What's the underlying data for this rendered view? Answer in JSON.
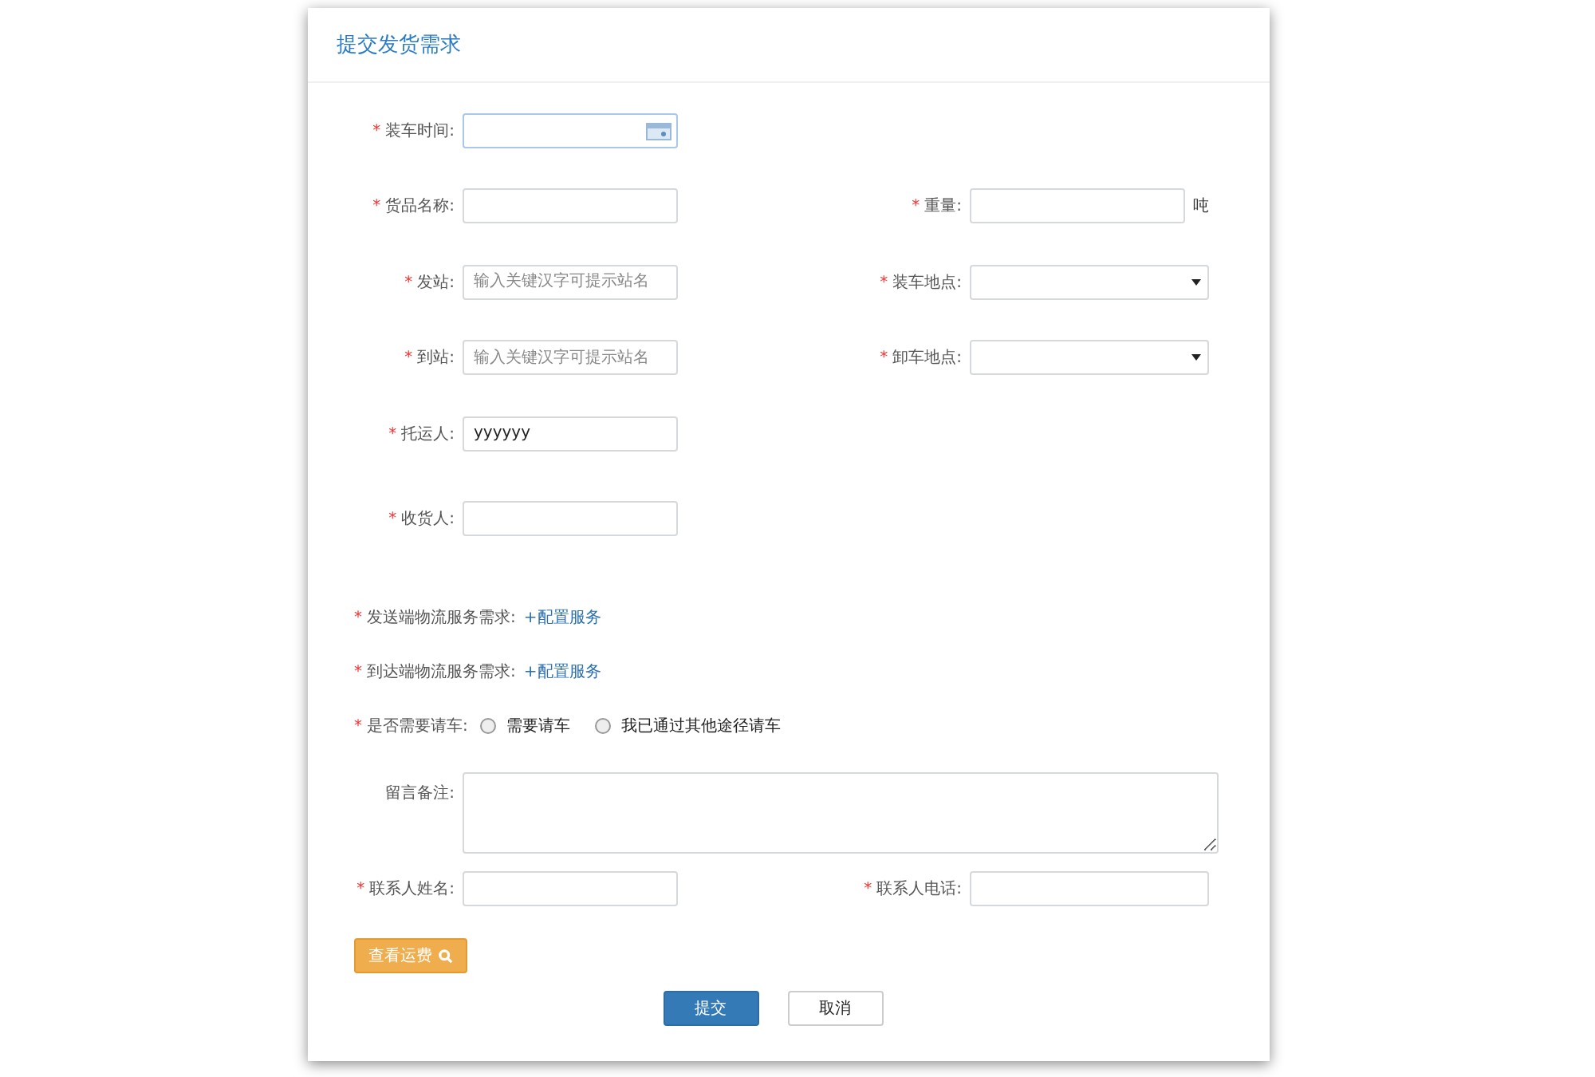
{
  "title": "提交发货需求",
  "rows": [
    {
      "kind": "fields",
      "cells": [
        {
          "kind": "date",
          "label": "装车时间:",
          "required_mark": "*"
        }
      ]
    },
    {
      "kind": "fields",
      "cells": [
        {
          "kind": "text",
          "label": "货品名称:",
          "required_mark": "*"
        },
        {
          "kind": "text",
          "label": "重量:",
          "required_mark": "*",
          "unit": "吨"
        }
      ]
    },
    {
      "kind": "fields",
      "cells": [
        {
          "kind": "text",
          "label": "发站:",
          "required_mark": "*",
          "placeholder": "输入关键汉字可提示站名"
        },
        {
          "kind": "select",
          "label": "装车地点:",
          "required_mark": "*"
        }
      ]
    },
    {
      "kind": "fields",
      "cells": [
        {
          "kind": "text",
          "label": "到站:",
          "required_mark": "*",
          "placeholder": "输入关键汉字可提示站名"
        },
        {
          "kind": "select",
          "label": "卸车地点:",
          "required_mark": "*"
        }
      ]
    },
    {
      "kind": "fields",
      "cells": [
        {
          "kind": "text",
          "label": "托运人:",
          "required_mark": "*",
          "value": "yyyyyy"
        }
      ]
    },
    {
      "kind": "fields",
      "cells": [
        {
          "kind": "text",
          "label": "收货人:",
          "required_mark": "*"
        }
      ]
    },
    {
      "kind": "service",
      "label": "发送端物流服务需求:",
      "required_mark": "*",
      "link": "+配置服务"
    },
    {
      "kind": "service",
      "label": "到达端物流服务需求:",
      "required_mark": "*",
      "link": "+配置服务"
    },
    {
      "kind": "radio",
      "label": "是否需要请车:",
      "required_mark": "*",
      "options": [
        {
          "label": "需要请车",
          "selected": false
        },
        {
          "label": "我已通过其他途径请车",
          "selected": false
        }
      ]
    },
    {
      "kind": "textarea",
      "label": "留言备注:"
    },
    {
      "kind": "fields",
      "cells": [
        {
          "kind": "text",
          "label": "联系人姓名:",
          "required_mark": "*"
        },
        {
          "kind": "wide",
          "label": "联系人电话:",
          "required_mark": "*"
        }
      ]
    }
  ],
  "fee_button": "查看运费",
  "buttons": [
    {
      "kind": "primary",
      "label": "提交"
    },
    {
      "kind": "default",
      "label": "取消"
    }
  ]
}
